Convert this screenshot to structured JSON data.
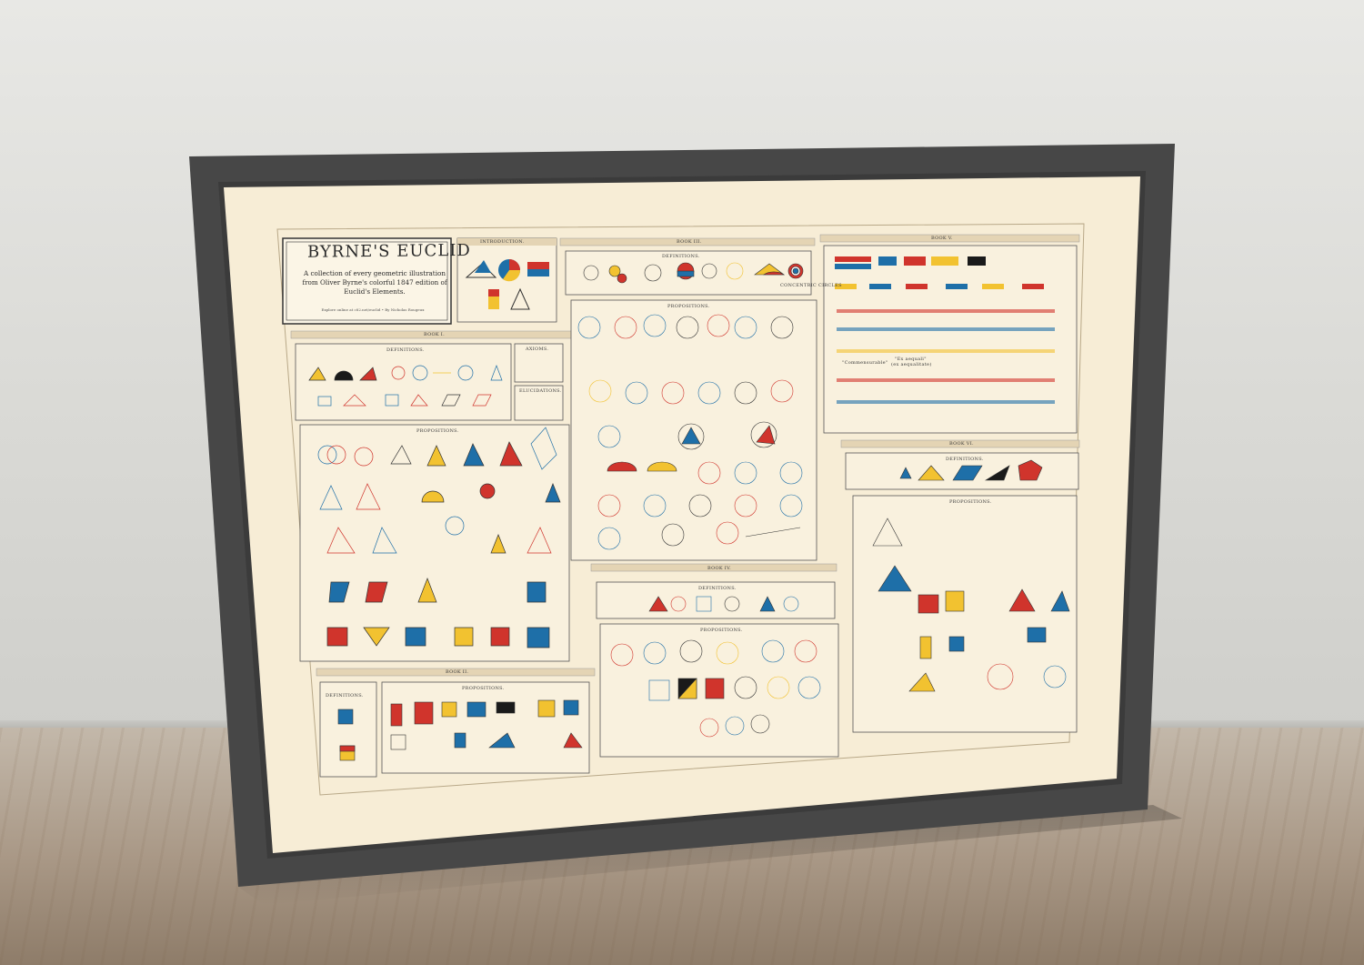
{
  "poster": {
    "title": "BYRNE'S EUCLID",
    "subtitle_line1": "A collection of every geometric illustration",
    "subtitle_line2": "from Oliver Byrne's colorful 1847 edition of",
    "subtitle_line3": "Euclid's Elements.",
    "credit": "Explore online at c82.net/euclid • By Nicholas Rougeux"
  },
  "sections": {
    "introduction": "INTRODUCTION.",
    "book1": "BOOK I.",
    "book1_definitions": "DEFINITIONS.",
    "book1_axioms": "AXIOMS.",
    "book1_elucidations": "ELUCIDATIONS.",
    "book1_propositions": "PROPOSITIONS.",
    "book2": "BOOK II.",
    "book2_definitions": "DEFINITIONS.",
    "book2_propositions": "PROPOSITIONS.",
    "book3": "BOOK III.",
    "book3_definitions": "DEFINITIONS.",
    "book3_propositions": "PROPOSITIONS.",
    "book3_concentric": "CONCENTRIC CIRCLES",
    "book4": "BOOK IV.",
    "book4_definitions": "DEFINITIONS.",
    "book4_propositions": "PROPOSITIONS.",
    "book5": "BOOK V.",
    "book6": "BOOK VI.",
    "book6_definitions": "DEFINITIONS.",
    "book6_propositions": "PROPOSITIONS."
  },
  "quotes": {
    "commensurable": "\"Commensurable\"",
    "ex_aequali": "\"Ex aequali\"",
    "ex_aequali2": "(ex aequalitate)"
  },
  "colors": {
    "red": "#d0342c",
    "yellow": "#f2c230",
    "blue": "#1e6fa8",
    "black": "#1a1a1a",
    "paper": "#f6ecd4",
    "frame": "#4a4a4a",
    "band": "#e6d7b9"
  }
}
